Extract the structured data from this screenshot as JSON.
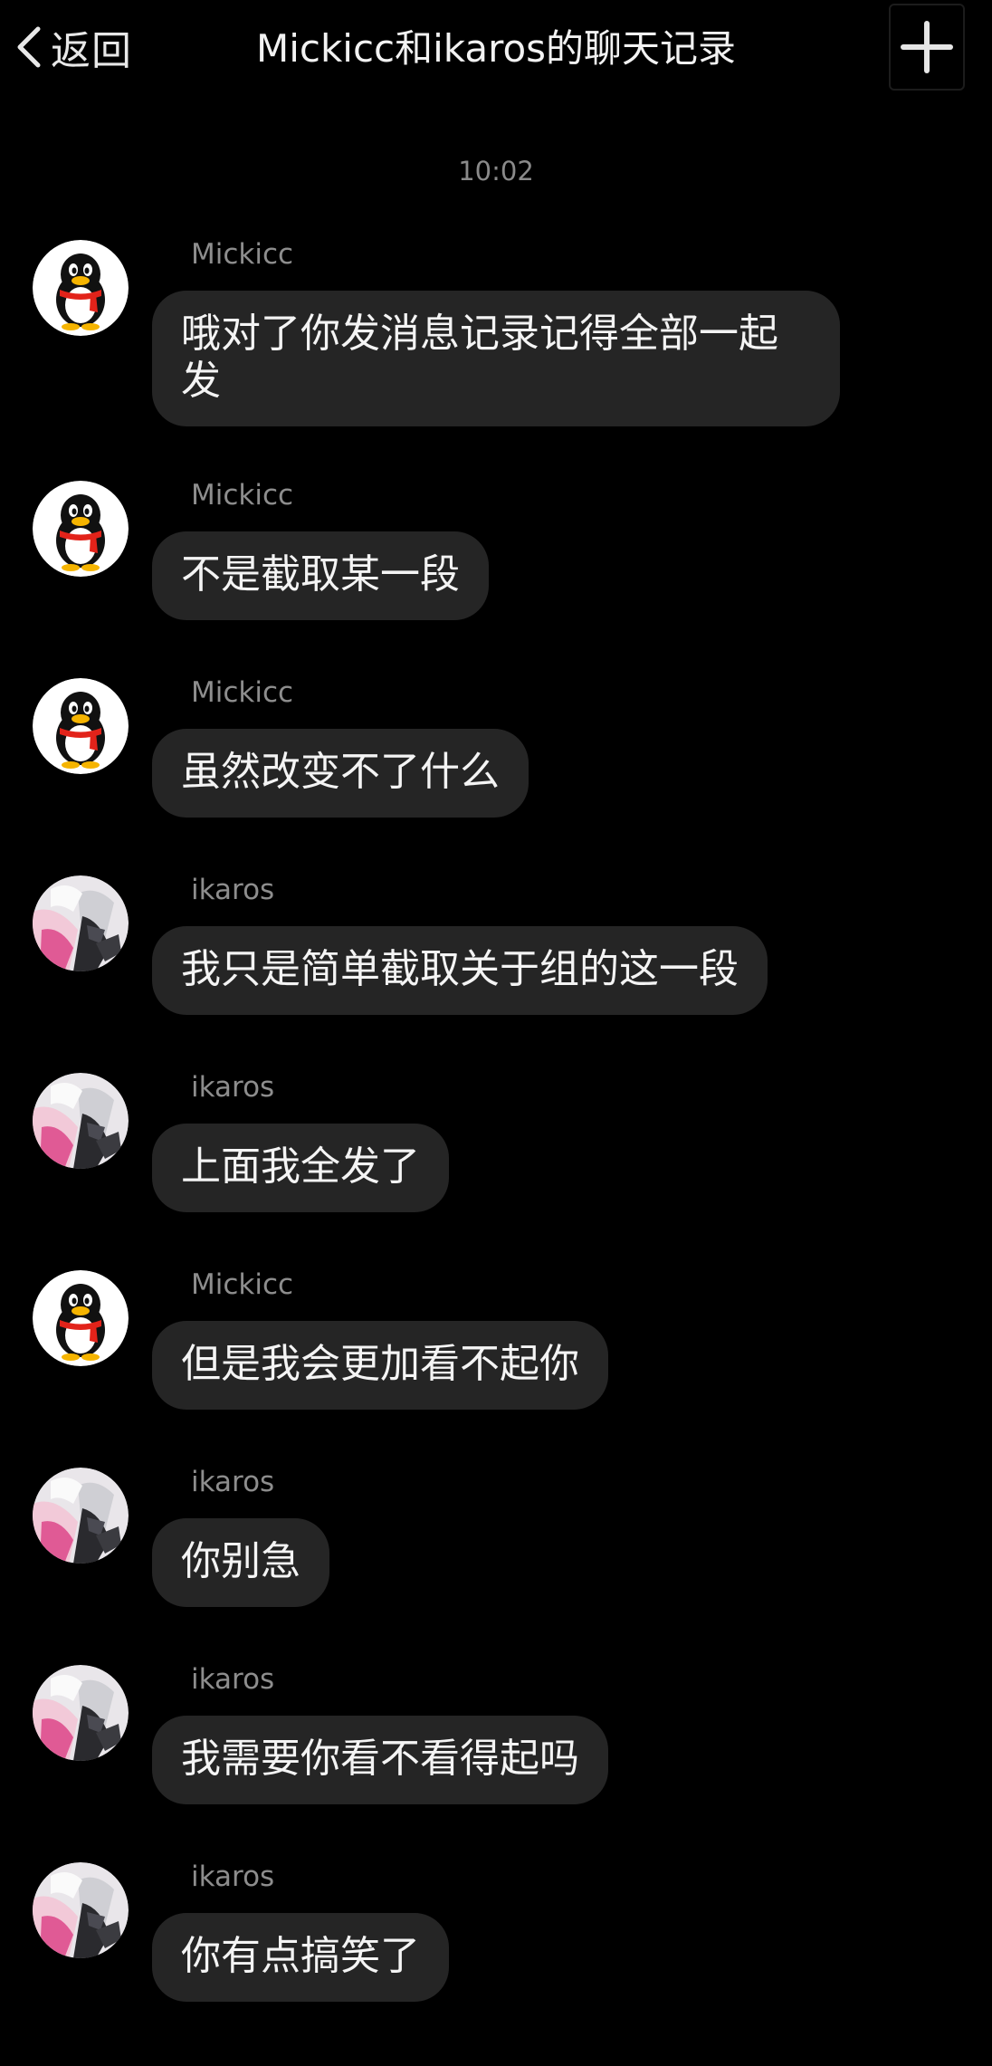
{
  "header": {
    "back_label": "返回",
    "title": "Mickicc和ikaros的聊天记录",
    "add_icon": "plus-icon"
  },
  "timestamp": "10:02",
  "messages": [
    {
      "sender": "Mickicc",
      "avatar": "penguin-avatar",
      "text": "哦对了你发消息记录记得全部一起发"
    },
    {
      "sender": "Mickicc",
      "avatar": "penguin-avatar",
      "text": "不是截取某一段"
    },
    {
      "sender": "Mickicc",
      "avatar": "penguin-avatar",
      "text": "虽然改变不了什么"
    },
    {
      "sender": "ikaros",
      "avatar": "anime-avatar",
      "text": "我只是简单截取关于组的这一段"
    },
    {
      "sender": "ikaros",
      "avatar": "anime-avatar",
      "text": "上面我全发了"
    },
    {
      "sender": "Mickicc",
      "avatar": "penguin-avatar",
      "text": "但是我会更加看不起你"
    },
    {
      "sender": "ikaros",
      "avatar": "anime-avatar",
      "text": "你别急"
    },
    {
      "sender": "ikaros",
      "avatar": "anime-avatar",
      "text": "我需要你看不看得起吗"
    },
    {
      "sender": "ikaros",
      "avatar": "anime-avatar",
      "text": "你有点搞笑了"
    }
  ],
  "colors": {
    "background": "#000000",
    "bubble": "#252525",
    "sender_text": "#8d8d8d",
    "penguin_scarf": "#e2231a"
  }
}
